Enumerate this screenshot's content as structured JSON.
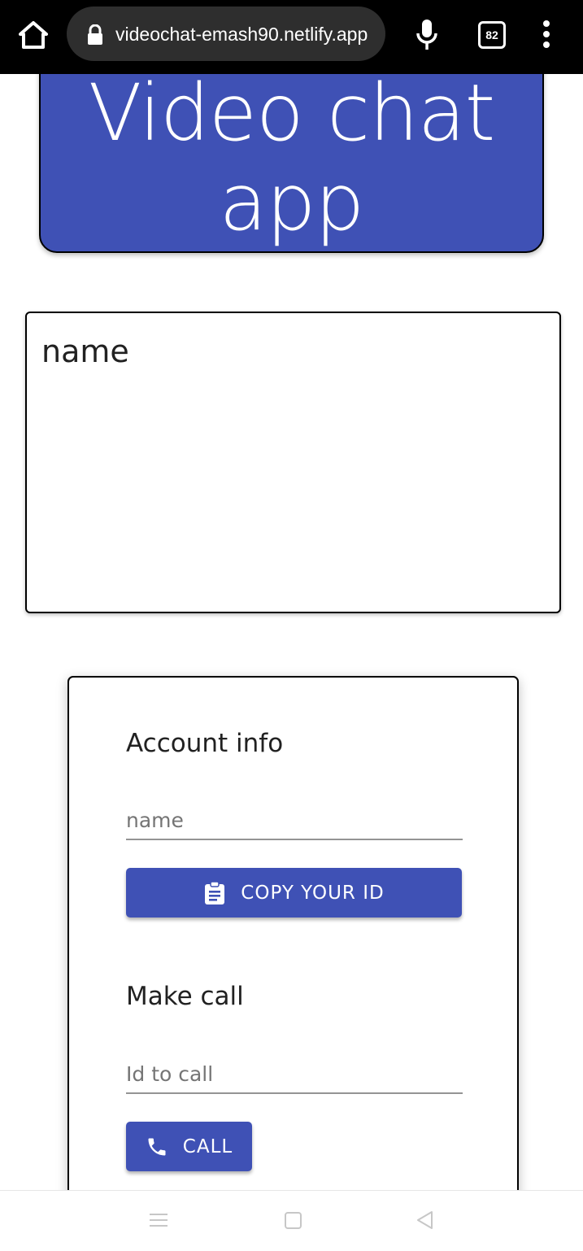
{
  "browser": {
    "url": "videochat-emash90.netlify.app",
    "tab_count": "82"
  },
  "header": {
    "title_line1": "Video chat",
    "title_line2": "app"
  },
  "video": {
    "name_label": "name"
  },
  "account": {
    "title": "Account info",
    "name_placeholder": "name",
    "copy_button_label": "COPY YOUR ID"
  },
  "make_call": {
    "title": "Make call",
    "id_placeholder": "Id to call",
    "call_button_label": "CALL"
  },
  "colors": {
    "primary": "#3f51b5",
    "browser_bar": "#000000"
  },
  "icons": {
    "home": "home-icon",
    "lock": "lock-icon",
    "mic": "mic-icon",
    "menu": "more-vert-icon",
    "clipboard": "assignment-icon",
    "phone": "phone-icon",
    "nav_menu": "menu-icon",
    "nav_home": "square-icon",
    "nav_back": "back-triangle-icon"
  }
}
